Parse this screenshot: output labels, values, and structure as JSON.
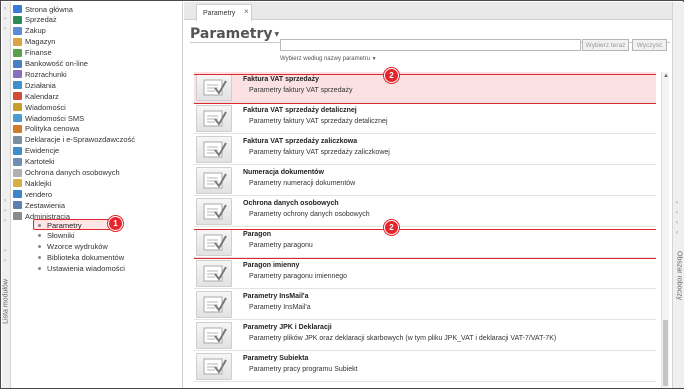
{
  "window": {
    "tab_title": "Parametry",
    "tab_close": "×"
  },
  "left_strip": {
    "label": "Lista modułów"
  },
  "right_strip": {
    "label": "Obszar roboczy"
  },
  "nav": {
    "items": [
      {
        "label": "Strona główna",
        "color": "#3a7bd5"
      },
      {
        "label": "Sprzedaż",
        "color": "#2e8b57"
      },
      {
        "label": "Zakup",
        "color": "#5b8bd6"
      },
      {
        "label": "Magazyn",
        "color": "#d9a441"
      },
      {
        "label": "Finanse",
        "color": "#5aa04a"
      },
      {
        "label": "Bankowość on-line",
        "color": "#4a7fc1"
      },
      {
        "label": "Rozrachunki",
        "color": "#8a6fc0"
      },
      {
        "label": "Działania",
        "color": "#3f8fd0"
      },
      {
        "label": "Kalendarz",
        "color": "#d14b3b"
      },
      {
        "label": "Wiadomości",
        "color": "#c7a02c"
      },
      {
        "label": "Wiadomości SMS",
        "color": "#4a9bd5"
      },
      {
        "label": "Polityka cenowa",
        "color": "#d07a2e"
      },
      {
        "label": "Deklaracje i e-Sprawozdawczość",
        "color": "#7c8f9e"
      },
      {
        "label": "Ewidencje",
        "color": "#3d8ec9"
      },
      {
        "label": "Kartoteki",
        "color": "#6d8fb2"
      },
      {
        "label": "Ochrona danych osobowych",
        "color": "#b0b0b0"
      },
      {
        "label": "Naklejki",
        "color": "#d6b046"
      },
      {
        "label": "vendero",
        "color": "#3a86c8"
      },
      {
        "label": "Zestawienia",
        "color": "#5b7fb0"
      },
      {
        "label": "Administracja",
        "color": "#8a8a8a"
      }
    ],
    "sub_items": [
      {
        "label": "Parametry",
        "active": true
      },
      {
        "label": "Słowniki",
        "active": false
      },
      {
        "label": "Wzorce wydruków",
        "active": false
      },
      {
        "label": "Biblioteka dokumentów",
        "active": false
      },
      {
        "label": "Ustawienia wiadomości",
        "active": false
      }
    ]
  },
  "main": {
    "page_title": "Parametry",
    "search": {
      "value": "",
      "placeholder": ""
    },
    "search_button": "Wybierz teraz",
    "clear_button": "Wyczyść",
    "filter_link": "Wybierz według nazwy parametru",
    "rows": [
      {
        "title": "Faktura VAT sprzedaży",
        "desc": "Parametry faktury VAT sprzedaży",
        "highlight": true
      },
      {
        "title": "Faktura VAT sprzedaży detalicznej",
        "desc": "Parametry faktury VAT sprzedaży detalicznej",
        "highlight": false
      },
      {
        "title": "Faktura VAT sprzedaży zaliczkowa",
        "desc": "Parametry faktury VAT sprzedaży zaliczkowej",
        "highlight": false
      },
      {
        "title": "Numeracja dokumentów",
        "desc": "Parametry numeracji dokumentów",
        "highlight": false
      },
      {
        "title": "Ochrona danych osobowych",
        "desc": "Parametry ochrony danych osobowych",
        "highlight": false
      },
      {
        "title": "Paragon",
        "desc": "Parametry paragonu",
        "highlight": false
      },
      {
        "title": "Paragon imienny",
        "desc": "Parametry paragonu imiennego",
        "highlight": false
      },
      {
        "title": "Parametry InsMail'a",
        "desc": "Parametry InsMail'a",
        "highlight": false
      },
      {
        "title": "Parametry JPK i Deklaracji",
        "desc": "Parametry plików JPK oraz deklaracji skarbowych (w tym pliku JPK_VAT i deklaracji VAT-7/VAT-7K)",
        "highlight": false
      },
      {
        "title": "Parametry Subiekta",
        "desc": "Parametry pracy programu Subiekt",
        "highlight": false
      }
    ]
  },
  "annotations": {
    "badge_1": "1",
    "badge_2a": "2",
    "badge_2b": "2"
  },
  "colors": {
    "accent_red": "#e2262e",
    "highlight_bg": "#fbe1e1"
  }
}
